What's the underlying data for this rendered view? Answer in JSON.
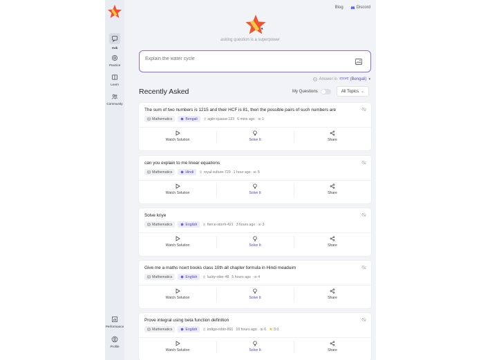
{
  "nav": {
    "ask": "Ask",
    "practice": "Practice",
    "learn": "Learn",
    "community": "Community",
    "performance": "Performance",
    "profile": "Profile"
  },
  "header": {
    "blog": "Blog",
    "discord": "Discord"
  },
  "hero": {
    "tagline": "asking question is a superpower"
  },
  "ask": {
    "placeholder": "Explain the water cycle"
  },
  "answer_in": {
    "label": "Answer in",
    "language": "বাংলা (Bengali)"
  },
  "recent": {
    "title": "Recently Asked",
    "my_questions": "My Questions",
    "topics": "All Topics"
  },
  "actions": {
    "watch": "Watch Solution",
    "solve": "Solve It",
    "share": "Share"
  },
  "questions": [
    {
      "text": "The sum of two numbers is 1215 and their HCF is 81, then the possible pairs of such numbers are",
      "subject": "Mathematics",
      "language": "Bengali",
      "user": "agile-quasar-123",
      "time": "6 mins ago",
      "views": "1",
      "rating": ""
    },
    {
      "text": "can you explain to me linear equations",
      "subject": "Mathematics",
      "language": "Hindi",
      "user": "royal-vulture-729",
      "time": "1 hour ago",
      "views": "5",
      "rating": ""
    },
    {
      "text": "Solve kriye",
      "subject": "Mathematics",
      "language": "English",
      "user": "fierce-storm-421",
      "time": "3 hours ago",
      "views": "3",
      "rating": ""
    },
    {
      "text": "Give me a maths ncert books class 10th all chapter formula in Hindi meaduim",
      "subject": "Mathematics",
      "language": "English",
      "user": "lucky-otter-48",
      "time": "5 hours ago",
      "views": "4",
      "rating": ""
    },
    {
      "text": "Prove integral using beta function definition",
      "subject": "Mathematics",
      "language": "English",
      "user": "indigo-robin-891",
      "time": "10 hours ago",
      "views": "6",
      "rating": "3.0"
    }
  ]
}
